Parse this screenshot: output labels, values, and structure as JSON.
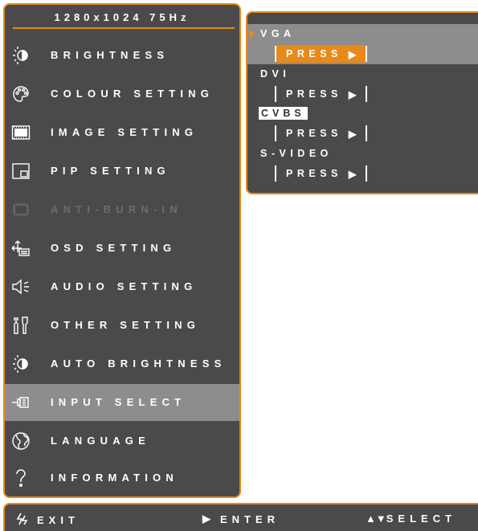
{
  "resolution": "1280x1024 75Hz",
  "menu": {
    "items": [
      {
        "label": "BRIGHTNESS",
        "icon": "brightness-icon"
      },
      {
        "label": "COLOUR SETTING",
        "icon": "palette-icon"
      },
      {
        "label": "IMAGE SETTING",
        "icon": "film-icon"
      },
      {
        "label": "PIP SETTING",
        "icon": "pip-icon"
      },
      {
        "label": "ANTI-BURN-IN",
        "icon": "chip-icon"
      },
      {
        "label": "OSD SETTING",
        "icon": "osd-icon"
      },
      {
        "label": "AUDIO SETTING",
        "icon": "speaker-icon"
      },
      {
        "label": "OTHER SETTING",
        "icon": "tools-icon"
      },
      {
        "label": "AUTO BRIGHTNESS",
        "icon": "auto-brightness-icon"
      },
      {
        "label": "INPUT SELECT",
        "icon": "plug-icon"
      },
      {
        "label": "LANGUAGE",
        "icon": "globe-icon"
      },
      {
        "label": "INFORMATION",
        "icon": "question-icon"
      }
    ],
    "selected": "INPUT SELECT",
    "disabled": "ANTI-BURN-IN"
  },
  "input_select": {
    "sources": [
      {
        "label": "VGA",
        "action": "PRESS"
      },
      {
        "label": "DVI",
        "action": "PRESS"
      },
      {
        "label": "CVBS",
        "action": "PRESS"
      },
      {
        "label": "S-VIDEO",
        "action": "PRESS"
      }
    ],
    "selected": "VGA",
    "boxed": "CVBS"
  },
  "status_bar": {
    "exit": "EXIT",
    "enter": "ENTER",
    "select": "SELECT"
  },
  "colors": {
    "accent": "#e88a1a",
    "panel": "#4a4a4a",
    "highlight": "#8d8d8d"
  }
}
